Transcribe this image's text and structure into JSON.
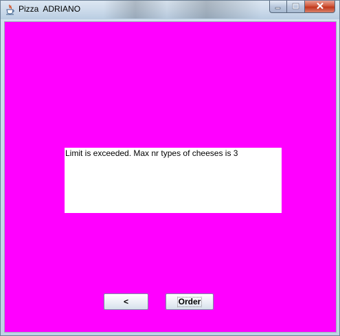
{
  "window": {
    "title": "Pizza  ADRIANO",
    "icon": "java-cup-icon",
    "controls": {
      "minimize": "minimize-icon",
      "maximize": "maximize-icon",
      "close": "close-icon"
    }
  },
  "main": {
    "background_color": "#ff00ff",
    "message": "Limit is exceeded. Max nr types of cheeses is 3"
  },
  "buttons": {
    "back_label": "<",
    "order_label": "Order"
  }
}
